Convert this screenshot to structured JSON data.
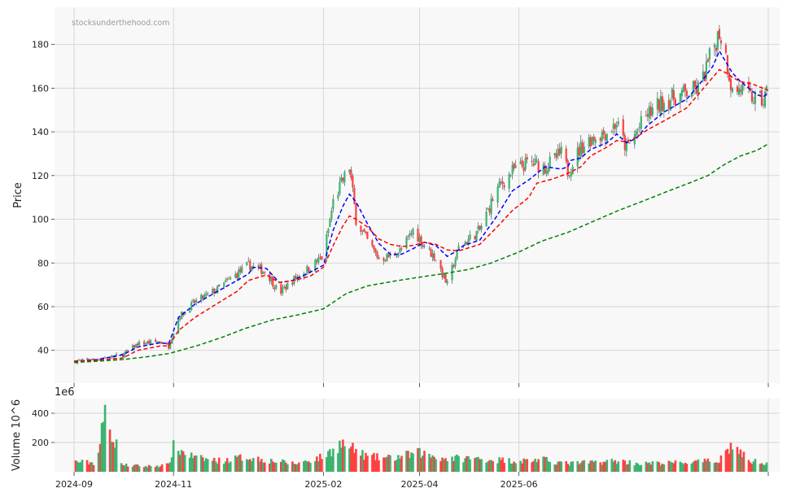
{
  "chart_data": {
    "type": "candlestick",
    "watermark": "stocksunderthehood.com",
    "price_panel": {
      "ylabel": "Price",
      "ylim": [
        25,
        197
      ],
      "yticks": [
        40,
        60,
        80,
        100,
        120,
        140,
        160,
        180
      ],
      "grid": true,
      "up_color": "#26a69a",
      "candle_up_color": "#3cb371",
      "candle_down_color": "#ff4040",
      "moving_averages": [
        {
          "style": "dashed",
          "color": "#0000ff",
          "points": [
            [
              "2024-09-01",
              35
            ],
            [
              "2024-09-15",
              35.8
            ],
            [
              "2024-10-01",
              38
            ],
            [
              "2024-10-10",
              41.5
            ],
            [
              "2024-10-24",
              43.5
            ],
            [
              "2024-10-29",
              43
            ],
            [
              "2024-11-04",
              55
            ],
            [
              "2024-11-14",
              61
            ],
            [
              "2024-11-28",
              67
            ],
            [
              "2024-12-10",
              72
            ],
            [
              "2024-12-17",
              75
            ],
            [
              "2024-12-20",
              78
            ],
            [
              "2024-12-28",
              77.5
            ],
            [
              "2025-01-05",
              71
            ],
            [
              "2025-01-13",
              72
            ],
            [
              "2025-01-22",
              75
            ],
            [
              "2025-02-01",
              79
            ],
            [
              "2025-02-07",
              95
            ],
            [
              "2025-02-13",
              106
            ],
            [
              "2025-02-17",
              111.5
            ],
            [
              "2025-02-21",
              108
            ],
            [
              "2025-02-28",
              98
            ],
            [
              "2025-03-07",
              89
            ],
            [
              "2025-03-14",
              84
            ],
            [
              "2025-03-21",
              84
            ],
            [
              "2025-03-28",
              86.5
            ],
            [
              "2025-04-04",
              89.5
            ],
            [
              "2025-04-11",
              88
            ],
            [
              "2025-04-18",
              83
            ],
            [
              "2025-04-25",
              86
            ],
            [
              "2025-04-28",
              88
            ],
            [
              "2025-05-08",
              90.5
            ],
            [
              "2025-05-18",
              101
            ],
            [
              "2025-05-28",
              113
            ],
            [
              "2025-06-07",
              118
            ],
            [
              "2025-06-17",
              124
            ],
            [
              "2025-06-27",
              123
            ],
            [
              "2025-07-01",
              124
            ],
            [
              "2025-07-03",
              127
            ],
            [
              "2025-07-09",
              128
            ],
            [
              "2025-07-15",
              132
            ],
            [
              "2025-07-25",
              135
            ],
            [
              "2025-07-31",
              139
            ],
            [
              "2025-08-06",
              135
            ],
            [
              "2025-08-12",
              137
            ],
            [
              "2025-08-19",
              143
            ],
            [
              "2025-08-29",
              149
            ],
            [
              "2025-09-12",
              155
            ],
            [
              "2025-09-20",
              162
            ],
            [
              "2025-09-28",
              170
            ],
            [
              "2025-10-02",
              177
            ],
            [
              "2025-10-06",
              172
            ],
            [
              "2025-10-10",
              167
            ],
            [
              "2025-10-15",
              163
            ],
            [
              "2025-10-20",
              160
            ],
            [
              "2025-10-25",
              157
            ],
            [
              "2025-10-29",
              156
            ],
            [
              "2025-11-01",
              158
            ]
          ]
        },
        {
          "style": "dashed",
          "color": "#ff0000",
          "points": [
            [
              "2024-09-01",
              35
            ],
            [
              "2024-09-15",
              35.5
            ],
            [
              "2024-10-01",
              36.5
            ],
            [
              "2024-10-10",
              40
            ],
            [
              "2024-10-24",
              42
            ],
            [
              "2024-10-29",
              42
            ],
            [
              "2024-11-04",
              49
            ],
            [
              "2024-11-14",
              55
            ],
            [
              "2024-11-28",
              61.5
            ],
            [
              "2024-12-10",
              67
            ],
            [
              "2024-12-17",
              72
            ],
            [
              "2024-12-28",
              74.5
            ],
            [
              "2025-01-05",
              71
            ],
            [
              "2025-01-14",
              72
            ],
            [
              "2025-01-24",
              74
            ],
            [
              "2025-02-01",
              78
            ],
            [
              "2025-02-07",
              88
            ],
            [
              "2025-02-13",
              97
            ],
            [
              "2025-02-17",
              101.5
            ],
            [
              "2025-02-21",
              100
            ],
            [
              "2025-02-28",
              96.5
            ],
            [
              "2025-03-07",
              91
            ],
            [
              "2025-03-14",
              88.5
            ],
            [
              "2025-03-21",
              87.5
            ],
            [
              "2025-03-28",
              88
            ],
            [
              "2025-04-04",
              89.5
            ],
            [
              "2025-04-11",
              88.5
            ],
            [
              "2025-04-18",
              86
            ],
            [
              "2025-04-25",
              85.5
            ],
            [
              "2025-05-08",
              88.5
            ],
            [
              "2025-05-18",
              96
            ],
            [
              "2025-05-28",
              104
            ],
            [
              "2025-06-07",
              110
            ],
            [
              "2025-06-12",
              116.5
            ],
            [
              "2025-06-22",
              118.5
            ],
            [
              "2025-07-01",
              121
            ],
            [
              "2025-07-09",
              124
            ],
            [
              "2025-07-15",
              129
            ],
            [
              "2025-07-25",
              133
            ],
            [
              "2025-07-31",
              136
            ],
            [
              "2025-08-06",
              135.5
            ],
            [
              "2025-08-12",
              137.5
            ],
            [
              "2025-08-19",
              141
            ],
            [
              "2025-08-29",
              145
            ],
            [
              "2025-09-12",
              151
            ],
            [
              "2025-09-20",
              158
            ],
            [
              "2025-09-28",
              165
            ],
            [
              "2025-10-02",
              168.5
            ],
            [
              "2025-10-06",
              167
            ],
            [
              "2025-10-10",
              165
            ],
            [
              "2025-10-15",
              163
            ],
            [
              "2025-10-22",
              162
            ],
            [
              "2025-11-01",
              159
            ]
          ]
        },
        {
          "style": "dashed",
          "color": "#008000",
          "points": [
            [
              "2024-09-01",
              34.5
            ],
            [
              "2024-09-15",
              35
            ],
            [
              "2024-10-01",
              35.8
            ],
            [
              "2024-10-15",
              37
            ],
            [
              "2024-10-29",
              38.5
            ],
            [
              "2024-11-15",
              42
            ],
            [
              "2024-12-01",
              46
            ],
            [
              "2024-12-15",
              50
            ],
            [
              "2025-01-01",
              54
            ],
            [
              "2025-01-15",
              56
            ],
            [
              "2025-02-01",
              59
            ],
            [
              "2025-02-15",
              66
            ],
            [
              "2025-02-28",
              69.5
            ],
            [
              "2025-03-15",
              71.5
            ],
            [
              "2025-04-01",
              73.5
            ],
            [
              "2025-04-15",
              75
            ],
            [
              "2025-05-01",
              77
            ],
            [
              "2025-05-15",
              80
            ],
            [
              "2025-06-01",
              85
            ],
            [
              "2025-06-15",
              90
            ],
            [
              "2025-07-01",
              94
            ],
            [
              "2025-07-15",
              98.5
            ],
            [
              "2025-08-01",
              104
            ],
            [
              "2025-08-15",
              108
            ],
            [
              "2025-09-01",
              113
            ],
            [
              "2025-09-15",
              117
            ],
            [
              "2025-09-25",
              120
            ],
            [
              "2025-10-05",
              125
            ],
            [
              "2025-10-15",
              129
            ],
            [
              "2025-10-25",
              131.5
            ],
            [
              "2025-11-01",
              134.5
            ]
          ]
        }
      ]
    },
    "volume_panel": {
      "ylabel": "Volume  10^6",
      "exponent_label": "1e6",
      "ylim": [
        0,
        500
      ],
      "yticks": [
        200,
        400
      ],
      "ytick_labels": [
        "200",
        "400"
      ],
      "grid": true
    },
    "x_axis": {
      "range": [
        "2024-08-20",
        "2025-11-08"
      ],
      "ticks": [
        "2024-09-01",
        "2024-11-01",
        "2025-02-01",
        "2025-04-01",
        "2025-06-01",
        "2025-11-01"
      ],
      "tick_labels": [
        "2024-09",
        "2024-11",
        "2025-02",
        "2025-04",
        "2025-06",
        ""
      ]
    },
    "price_anchors": [
      [
        "2024-09-01",
        35
      ],
      [
        "2024-09-15",
        36
      ],
      [
        "2024-10-01",
        38
      ],
      [
        "2024-10-10",
        43
      ],
      [
        "2024-10-24",
        44
      ],
      [
        "2024-10-29",
        42
      ],
      [
        "2024-11-04",
        55
      ],
      [
        "2024-11-14",
        62
      ],
      [
        "2024-11-28",
        68
      ],
      [
        "2024-12-10",
        75
      ],
      [
        "2024-12-17",
        79
      ],
      [
        "2024-12-28",
        76
      ],
      [
        "2025-01-05",
        66
      ],
      [
        "2025-01-13",
        72
      ],
      [
        "2025-01-22",
        77
      ],
      [
        "2025-02-01",
        83
      ],
      [
        "2025-02-07",
        108
      ],
      [
        "2025-02-13",
        118
      ],
      [
        "2025-02-17",
        124
      ],
      [
        "2025-02-21",
        100
      ],
      [
        "2025-02-28",
        90
      ],
      [
        "2025-03-07",
        82
      ],
      [
        "2025-03-14",
        83
      ],
      [
        "2025-03-21",
        86
      ],
      [
        "2025-03-28",
        95
      ],
      [
        "2025-04-04",
        88
      ],
      [
        "2025-04-11",
        82
      ],
      [
        "2025-04-18",
        70
      ],
      [
        "2025-04-25",
        87
      ],
      [
        "2025-05-08",
        95
      ],
      [
        "2025-05-18",
        113
      ],
      [
        "2025-05-28",
        122
      ],
      [
        "2025-06-07",
        126
      ],
      [
        "2025-06-17",
        124
      ],
      [
        "2025-06-27",
        130
      ],
      [
        "2025-07-01",
        122
      ],
      [
        "2025-07-09",
        133
      ],
      [
        "2025-07-15",
        137
      ],
      [
        "2025-07-25",
        140
      ],
      [
        "2025-07-31",
        144
      ],
      [
        "2025-08-06",
        132
      ],
      [
        "2025-08-12",
        140
      ],
      [
        "2025-08-19",
        148
      ],
      [
        "2025-08-29",
        154
      ],
      [
        "2025-09-12",
        158
      ],
      [
        "2025-09-20",
        160
      ],
      [
        "2025-09-28",
        178
      ],
      [
        "2025-10-02",
        186
      ],
      [
        "2025-10-06",
        175
      ],
      [
        "2025-10-10",
        158
      ],
      [
        "2025-10-15",
        160
      ],
      [
        "2025-10-20",
        156
      ],
      [
        "2025-10-25",
        155
      ],
      [
        "2025-10-29",
        154
      ],
      [
        "2025-11-01",
        160
      ]
    ],
    "volume_anchors": [
      [
        "2024-09-01",
        75
      ],
      [
        "2024-09-15",
        65
      ],
      [
        "2024-09-20",
        440
      ],
      [
        "2024-10-01",
        50
      ],
      [
        "2024-10-15",
        40
      ],
      [
        "2024-10-29",
        50
      ],
      [
        "2024-11-01",
        180
      ],
      [
        "2024-11-15",
        100
      ],
      [
        "2024-12-01",
        80
      ],
      [
        "2024-12-15",
        110
      ],
      [
        "2025-01-01",
        80
      ],
      [
        "2025-01-15",
        60
      ],
      [
        "2025-02-01",
        110
      ],
      [
        "2025-02-12",
        210
      ],
      [
        "2025-02-28",
        110
      ],
      [
        "2025-03-15",
        100
      ],
      [
        "2025-04-01",
        140
      ],
      [
        "2025-04-15",
        100
      ],
      [
        "2025-05-01",
        100
      ],
      [
        "2025-05-15",
        90
      ],
      [
        "2025-06-01",
        80
      ],
      [
        "2025-06-15",
        90
      ],
      [
        "2025-07-01",
        60
      ],
      [
        "2025-07-15",
        70
      ],
      [
        "2025-08-01",
        80
      ],
      [
        "2025-08-15",
        60
      ],
      [
        "2025-09-01",
        65
      ],
      [
        "2025-09-15",
        70
      ],
      [
        "2025-10-01",
        80
      ],
      [
        "2025-10-10",
        200
      ],
      [
        "2025-10-20",
        80
      ],
      [
        "2025-11-01",
        70
      ]
    ]
  }
}
